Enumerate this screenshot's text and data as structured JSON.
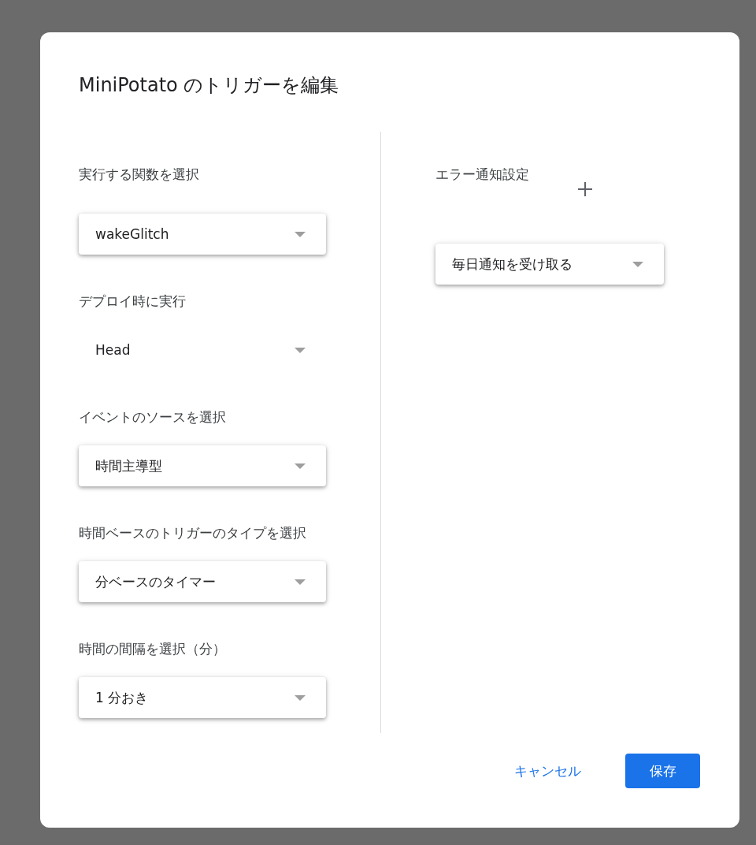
{
  "dialog": {
    "title": "MiniPotato のトリガーを編集"
  },
  "left_fields": [
    {
      "label": "実行する関数を選択",
      "value": "wakeGlitch",
      "kind": "raised"
    },
    {
      "label": "デプロイ時に実行",
      "value": "Head",
      "kind": "flat"
    },
    {
      "label": "イベントのソースを選択",
      "value": "時間主導型",
      "kind": "raised"
    },
    {
      "label": "時間ベースのトリガーのタイプを選択",
      "value": "分ベースのタイマー",
      "kind": "raised"
    },
    {
      "label": "時間の間隔を選択（分）",
      "value": "1 分おき",
      "kind": "raised"
    }
  ],
  "right_fields": [
    {
      "label": "エラー通知設定",
      "value": "毎日通知を受け取る",
      "kind": "raised"
    }
  ],
  "buttons": [
    {
      "label": "キャンセル",
      "kind": "text"
    },
    {
      "label": "保存",
      "kind": "primary"
    }
  ]
}
